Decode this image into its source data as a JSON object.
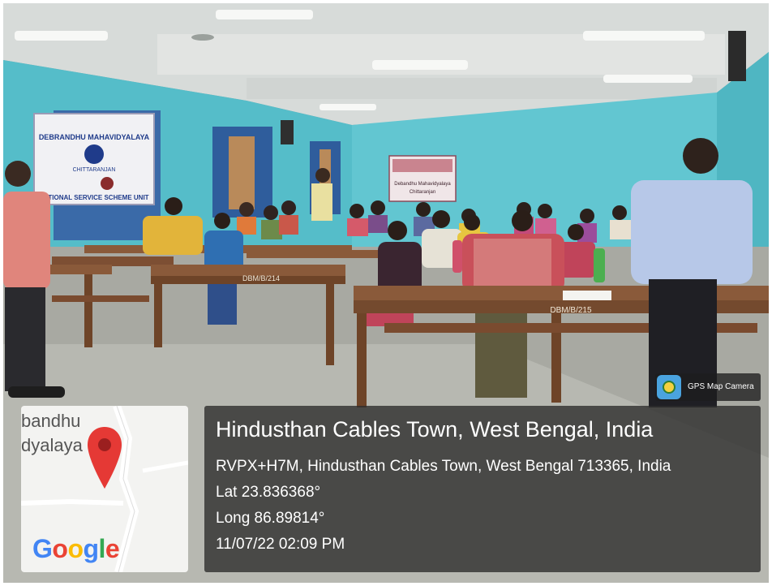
{
  "scene": {
    "banner_left": {
      "line1": "DEBRANDHU MAHAVIDYALAYA",
      "line2": "CHITTARANJAN",
      "line3": "NATIONAL SERVICE SCHEME UNIT"
    },
    "banner_center": {
      "line1": "Debandhu Mahavidyalaya",
      "line2": "Chittaranjan"
    },
    "desk_labels": [
      "DBM/B/214",
      "DBM/B/215"
    ]
  },
  "map": {
    "label_line1": "bandhu",
    "label_line2": "dyalaya",
    "brand": "Google",
    "brand_colors": [
      "#4285F4",
      "#EA4335",
      "#FBBC05",
      "#4285F4",
      "#34A853",
      "#EA4335"
    ],
    "pin_color": "#E53935"
  },
  "gps_badge": {
    "label": "GPS Map Camera"
  },
  "location": {
    "title": "Hindusthan Cables Town, West Bengal, India",
    "address": "RVPX+H7M, Hindusthan Cables Town, West Bengal 713365, India",
    "lat": "Lat 23.836368°",
    "long": "Long 86.89814°",
    "datetime": "11/07/22 02:09 PM"
  }
}
